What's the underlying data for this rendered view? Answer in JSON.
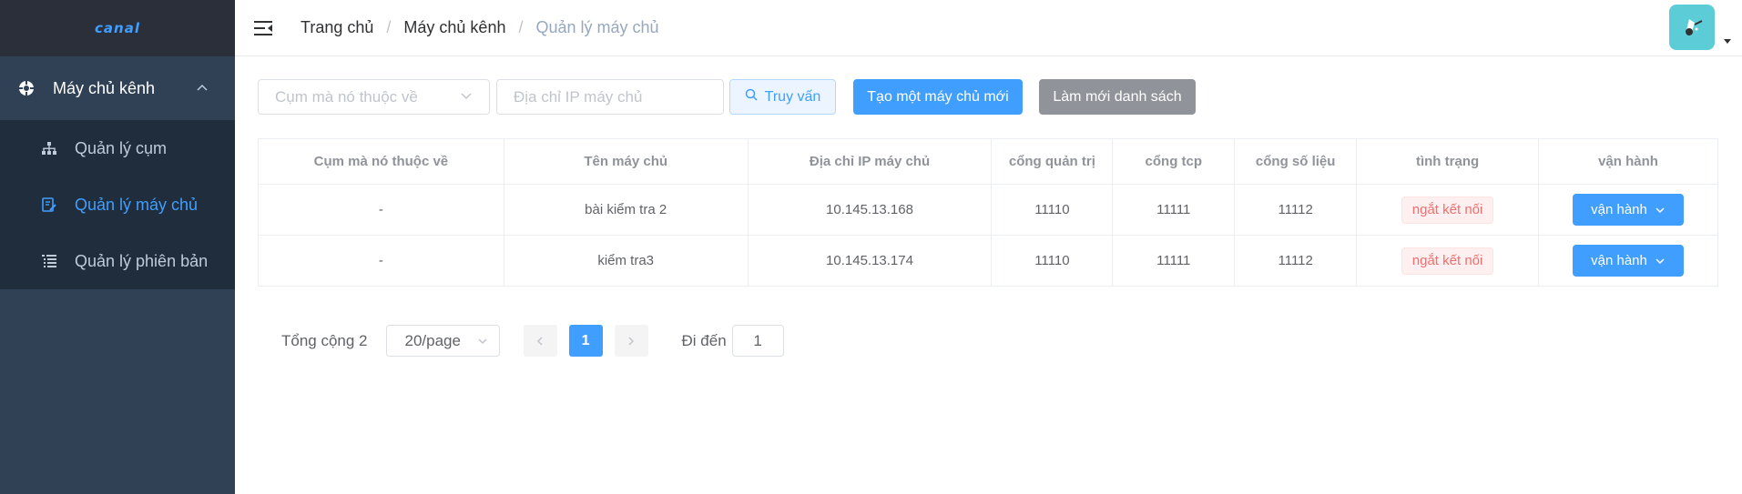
{
  "logo": {
    "text": "canal"
  },
  "sidebar": {
    "group": {
      "label": "Máy chủ kênh"
    },
    "items": [
      {
        "label": "Quản lý cụm",
        "active": false
      },
      {
        "label": "Quản lý máy chủ",
        "active": true
      },
      {
        "label": "Quản lý phiên bản",
        "active": false
      }
    ]
  },
  "breadcrumb": {
    "items": [
      "Trang chủ",
      "Máy chủ kênh",
      "Quản lý máy chủ"
    ],
    "separator": "/"
  },
  "filters": {
    "cluster_placeholder": "Cụm mà nó thuộc về",
    "ip_placeholder": "Địa chỉ IP máy chủ",
    "query_label": "Truy vấn",
    "create_label": "Tạo một máy chủ mới",
    "refresh_label": "Làm mới danh sách"
  },
  "table": {
    "headers": [
      "Cụm mà nó thuộc về",
      "Tên máy chủ",
      "Địa chỉ IP máy chủ",
      "cổng quản trị",
      "cổng tcp",
      "cổng số liệu",
      "tình trạng",
      "vận hành"
    ],
    "rows": [
      {
        "cluster": "-",
        "name": "bài kiểm tra 2",
        "ip": "10.145.13.168",
        "admin_port": "11110",
        "tcp_port": "11111",
        "metrics_port": "11112",
        "status": "ngắt kết nối",
        "action": "vận hành"
      },
      {
        "cluster": "-",
        "name": "kiểm tra3",
        "ip": "10.145.13.174",
        "admin_port": "11110",
        "tcp_port": "11111",
        "metrics_port": "11112",
        "status": "ngắt kết nối",
        "action": "vận hành"
      }
    ]
  },
  "pagination": {
    "total_label": "Tổng cộng 2",
    "page_size": "20/page",
    "current_page": "1",
    "goto_label": "Đi đến",
    "goto_value": "1"
  },
  "colors": {
    "sidebar_bg": "#304156",
    "submenu_bg": "#1f2d3d",
    "primary": "#409eff",
    "danger": "#f56c6c",
    "info": "#909399"
  }
}
